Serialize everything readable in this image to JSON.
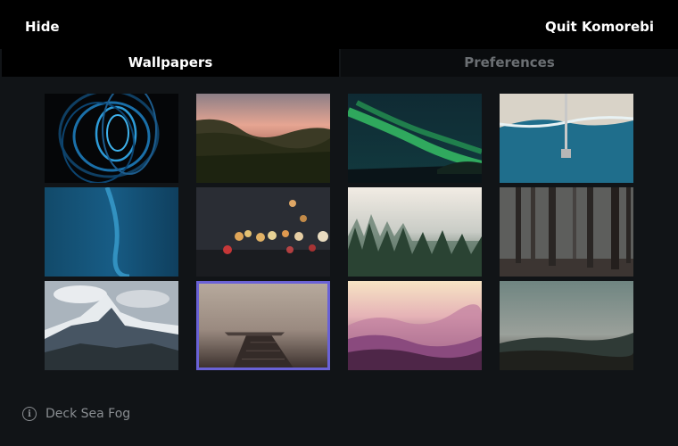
{
  "header": {
    "hide_label": "Hide",
    "quit_label": "Quit Komorebi"
  },
  "tabs": [
    {
      "label": "Wallpapers",
      "active": true
    },
    {
      "label": "Preferences",
      "active": false
    }
  ],
  "wallpapers": [
    {
      "name": "blue-light-swirl"
    },
    {
      "name": "sunset-forest-hills"
    },
    {
      "name": "aurora-borealis"
    },
    {
      "name": "aerial-pier-beach"
    },
    {
      "name": "deep-blue-water"
    },
    {
      "name": "city-bokeh-lights"
    },
    {
      "name": "misty-pine-forest"
    },
    {
      "name": "dark-tall-forest"
    },
    {
      "name": "snowy-mountain-peak"
    },
    {
      "name": "deck-sea-fog",
      "selected": true
    },
    {
      "name": "pink-haze-hills"
    },
    {
      "name": "teal-mountain-dusk"
    }
  ],
  "footer": {
    "icon": "info-icon",
    "selected_name": "Deck Sea Fog"
  },
  "colors": {
    "header_bg": "#000000",
    "body_bg": "#111417",
    "selection_border": "#6a62d6",
    "inactive_tab_text": "#6b6f73"
  }
}
